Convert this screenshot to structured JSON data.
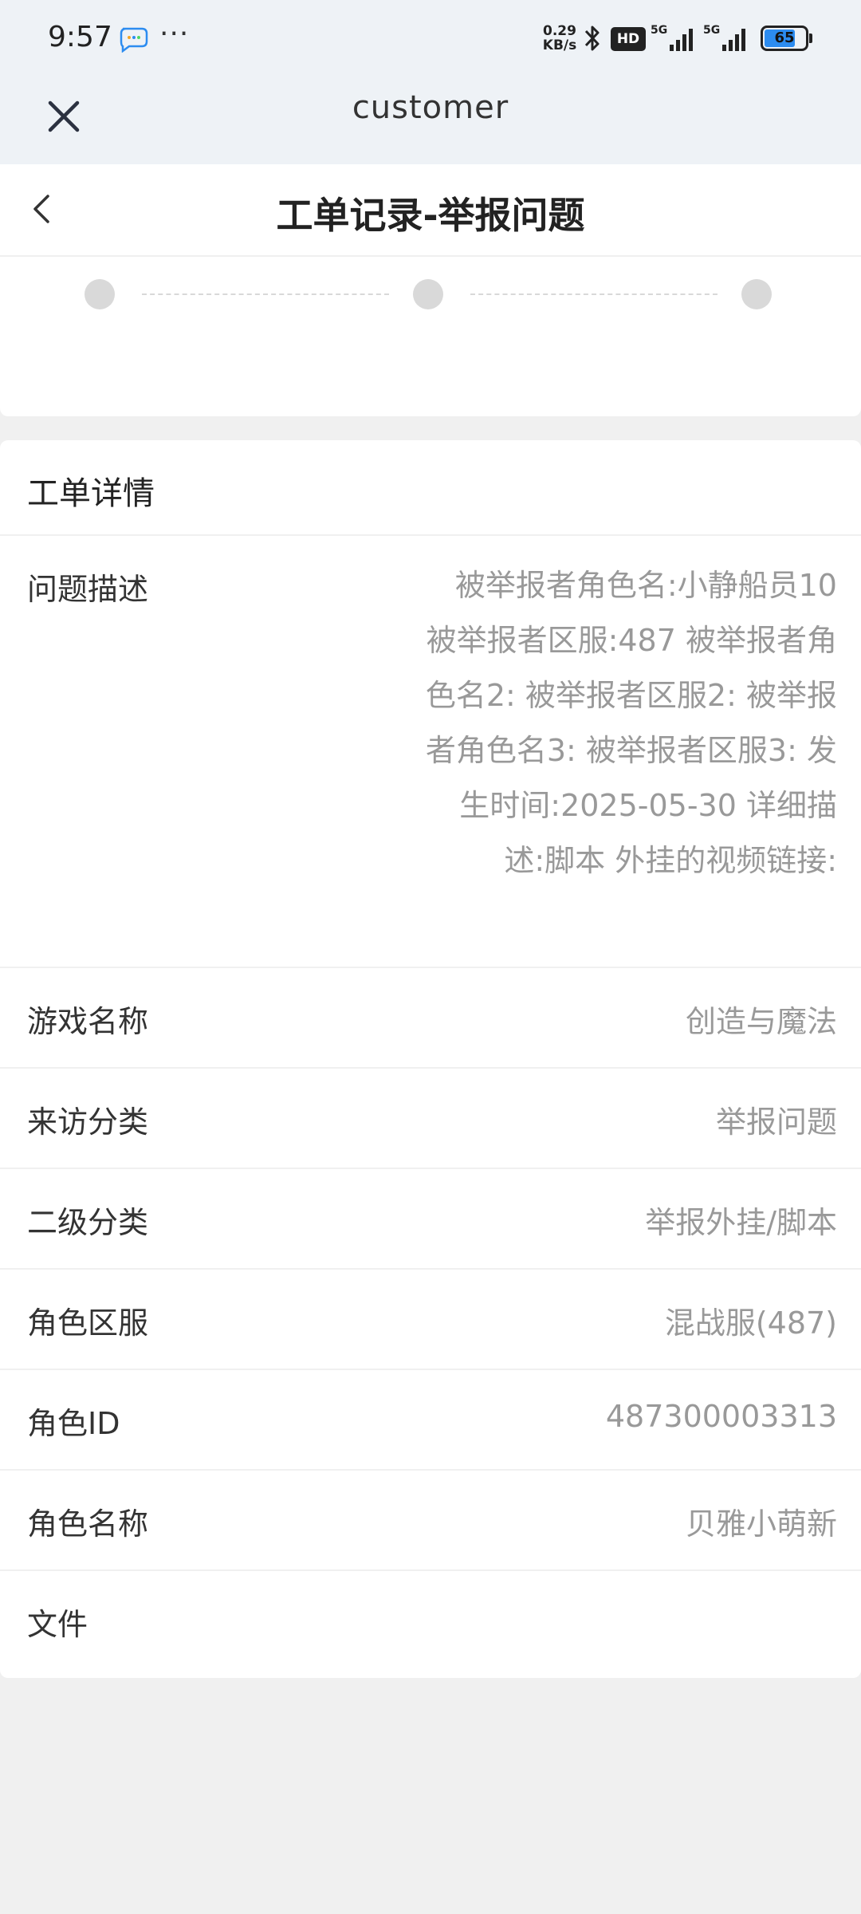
{
  "status_bar": {
    "time": "9:57",
    "net_speed_value": "0.29",
    "net_speed_unit": "KB/s",
    "hd_label": "HD",
    "signal1_label": "5G",
    "signal2_label": "5G",
    "battery_level": "65",
    "icons": [
      "chat-bubble-icon",
      "more-dots-icon",
      "bluetooth-icon",
      "hd-icon",
      "signal-icon",
      "signal-icon",
      "battery-icon"
    ]
  },
  "webview": {
    "title": "customer",
    "close_icon": "close-icon"
  },
  "header": {
    "title": "工单记录-举报问题",
    "back_icon": "chevron-left-icon"
  },
  "progress": {
    "steps": 3
  },
  "details": {
    "section_title": "工单详情",
    "description_label": "问题描述",
    "description_value": "被举报者角色名:小静船员10 被举报者区服:487 被举报者角色名2: 被举报者区服2: 被举报者角色名3: 被举报者区服3: 发生时间:2025-05-30 详细描述:脚本 外挂的视频链接:",
    "rows": [
      {
        "label": "游戏名称",
        "value": "创造与魔法"
      },
      {
        "label": "来访分类",
        "value": "举报问题"
      },
      {
        "label": "二级分类",
        "value": "举报外挂/脚本"
      },
      {
        "label": "角色区服",
        "value": "混战服(487)"
      },
      {
        "label": "角色ID",
        "value": "487300003313"
      },
      {
        "label": "角色名称",
        "value": "贝雅小萌新"
      },
      {
        "label": "文件",
        "value": ""
      }
    ]
  },
  "colors": {
    "top_background": "#eef2f6",
    "page_background": "#f0f0f0",
    "card_background": "#ffffff",
    "value_text": "#999999",
    "step_dot": "#d9d9d9",
    "battery_fill": "#2c8cf0"
  }
}
